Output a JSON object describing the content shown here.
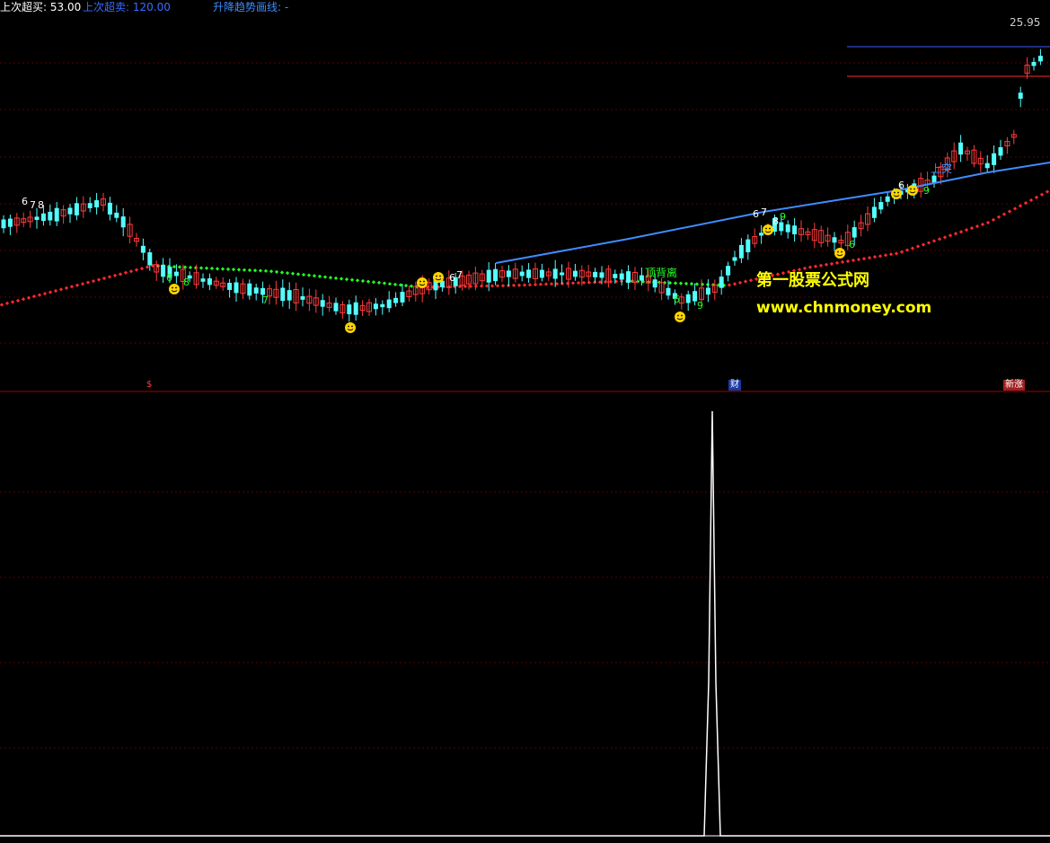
{
  "header": {
    "last_buy": "上次超买: 53.00",
    "last_sell": "上次超卖: 120.00",
    "trend_line": "升降趋势画线: -"
  },
  "price_label": "25.95",
  "annotations": {
    "top_divergence": "顶背离",
    "breakout": "上突"
  },
  "watermark": {
    "site_name": "第一股票公式网",
    "site_url": "www.chnmoney.com"
  },
  "markers": {
    "left": "$",
    "mid": "财",
    "right": "新涨"
  },
  "colors": {
    "background": "#000000",
    "up": "#ff3b3b",
    "down": "#54ffff",
    "grid": "#5a0000",
    "trend": "#3f8cff",
    "support_up": "#ff2a2a",
    "support_down": "#22ff22",
    "header_buy": "#ffffff",
    "header_sell": "#3b6cff",
    "header_trend": "#3b8cff",
    "watermark_site": "#ffff00",
    "watermark_url": "#ffff00",
    "spike": "#ffffff"
  }
}
